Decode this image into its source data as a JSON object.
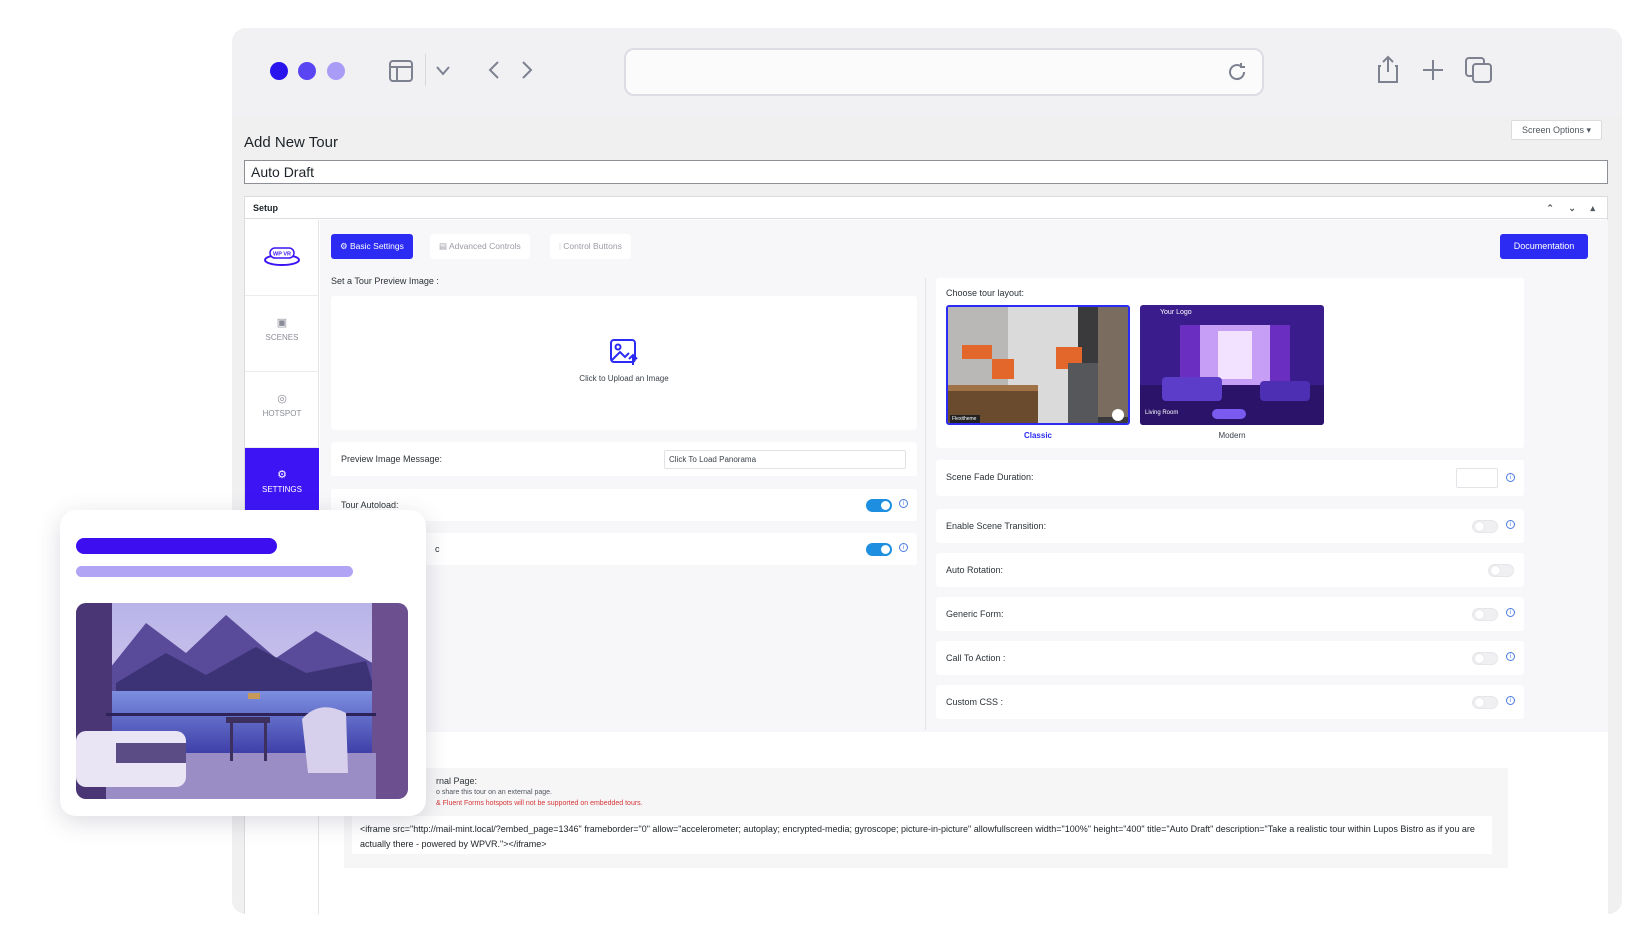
{
  "browser": {
    "traffic_lights": [
      "#2a14ee",
      "#5a45f2",
      "#a99cf6"
    ],
    "address": ""
  },
  "page": {
    "screen_options": "Screen Options ▾",
    "title": "Add New Tour",
    "tour_title_value": "Auto Draft",
    "setup_label": "Setup",
    "setup_arrows": "⌃ ⌄ ▴"
  },
  "sidebar": {
    "logo_text": "WP VR",
    "items": [
      {
        "label": "SCENES",
        "icon": "image-icon"
      },
      {
        "label": "HOTSPOT",
        "icon": "hotspot-icon"
      },
      {
        "label": "SETTINGS",
        "icon": "gear-icon"
      }
    ]
  },
  "tabs": [
    {
      "label": "Basic Settings",
      "icon": "⚙"
    },
    {
      "label": "Advanced Controls",
      "icon": "▤"
    },
    {
      "label": "Control Buttons",
      "icon": "⦙"
    }
  ],
  "documentation_label": "Documentation",
  "left": {
    "preview_image_label": "Set a Tour Preview Image :",
    "upload_text": "Click to Upload an Image",
    "preview_message_label": "Preview Image Message:",
    "preview_message_value": "Click To Load Panorama",
    "autoload_label": "Tour Autoload:",
    "autoload_on": true,
    "row2_label_fragment": "c",
    "row2_on": true
  },
  "right": {
    "layout_label": "Choose tour layout:",
    "layouts": [
      {
        "name": "Classic",
        "selected": true,
        "badge": "Flexitheme"
      },
      {
        "name": "Modern",
        "selected": false,
        "logo": "Your Logo",
        "room": "Living Room"
      }
    ],
    "settings": [
      {
        "label": "Scene Fade Duration:",
        "type": "input",
        "value": ""
      },
      {
        "label": "Enable Scene Transition:",
        "type": "toggle",
        "on": false
      },
      {
        "label": "Auto Rotation:",
        "type": "toggle",
        "on": false
      },
      {
        "label": "Generic Form:",
        "type": "toggle",
        "on": false
      },
      {
        "label": "Call To Action :",
        "type": "toggle",
        "on": false
      },
      {
        "label": "Custom CSS :",
        "type": "toggle",
        "on": false
      }
    ]
  },
  "embed": {
    "title_fragment": "rnal Page:",
    "sub_fragment": "o share this tour on an external page.",
    "warning_fragment": "& Fluent Forms hotspots will not be supported on embedded tours.",
    "code": "<iframe src=\"http://mail-mint.local/?embed_page=1346\" frameborder=\"0\" allow=\"accelerometer; autoplay; encrypted-media; gyroscope; picture-in-picture\" allowfullscreen width=\"100%\" height=\"400\" title=\"Auto Draft\" description=\"Take a realistic tour within Lupos Bistro as if you are actually there - powered by WPVR.\"></iframe>"
  },
  "colors": {
    "accent": "#2b2bf4",
    "sidebar_active": "#3d15f5",
    "toggle_on": "#1e8fe0",
    "warning": "#d63638"
  }
}
